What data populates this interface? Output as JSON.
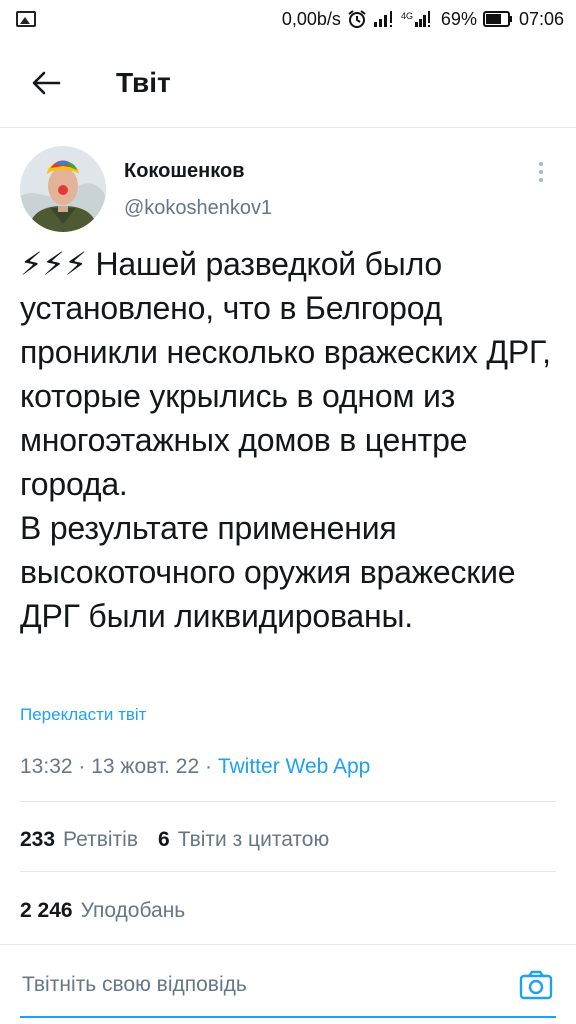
{
  "status_bar": {
    "speed": "0,00b/s",
    "battery": "69%",
    "time": "07:06",
    "network": "4G"
  },
  "app_bar": {
    "title": "Твіт",
    "back_icon": "arrow-left-icon"
  },
  "tweet": {
    "author_name": "Кокошенков",
    "author_handle": "@kokoshenkov1",
    "text": "⚡⚡⚡ Нашей разведкой было установлено, что в Белгород проникли несколько вражеских ДРГ, которые укрылись в одном из многоэтажных домов  в центре города.\nВ результате применения высокоточного оружия вражеские ДРГ были ликвидированы.",
    "translate_label": "Перекласти твіт",
    "time": "13:32",
    "date": "13 жовт. 22",
    "source": "Twitter Web App",
    "separator": " · "
  },
  "stats": {
    "retweets_count": "233",
    "retweets_label": "Ретвітів",
    "quotes_count": "6",
    "quotes_label": "Твіти з цитатою",
    "likes_count": "2 246",
    "likes_label": "Уподобань"
  },
  "reply": {
    "placeholder": "Твітніть свою відповідь",
    "camera_icon": "camera-icon"
  },
  "colors": {
    "accent": "#1da1f2",
    "text": "#14171a",
    "secondary": "#657786"
  }
}
